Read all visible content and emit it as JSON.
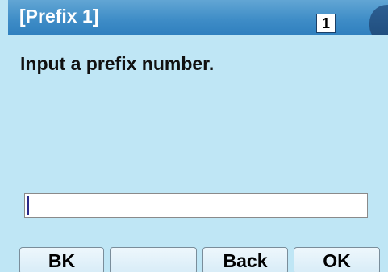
{
  "header": {
    "title": "[Prefix 1]",
    "line_indicator": "1"
  },
  "message": {
    "prompt": "Input a prefix number."
  },
  "input": {
    "value": ""
  },
  "softkeys": [
    {
      "label": "BK"
    },
    {
      "label": ""
    },
    {
      "label": "Back"
    },
    {
      "label": "OK"
    }
  ],
  "colors": {
    "screen_background": "#bfe6f5",
    "title_bar": "#3f8dc7",
    "softkey_background": "#d7ecf7"
  }
}
